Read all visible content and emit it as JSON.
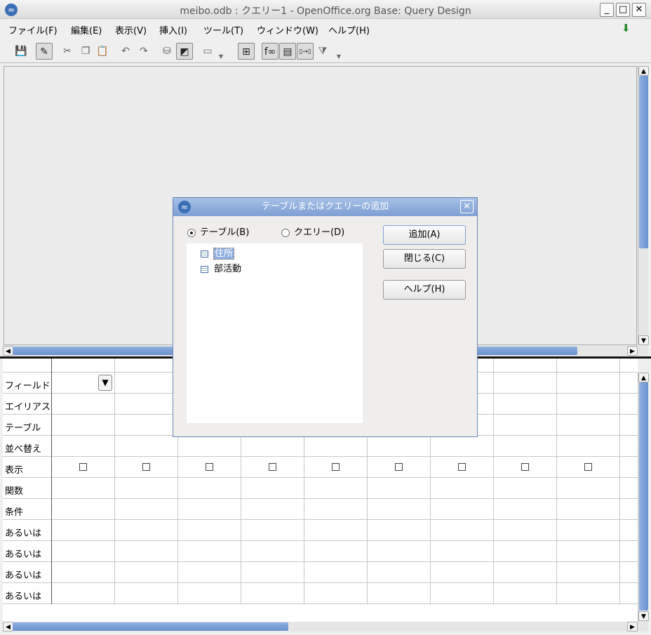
{
  "window": {
    "title": "meibo.odb : クエリー1  -  OpenOffice.org Base: Query Design",
    "minimize": "_",
    "maximize": "□",
    "close": "✕"
  },
  "menu": [
    "ファイル(F)",
    "編集(E)",
    "表示(V)",
    "挿入(I)",
    "ツール(T)",
    "ウィンドウ(W)",
    "ヘルプ(H)"
  ],
  "toolbar": [
    {
      "icon": "save-icon",
      "glyph": "💾",
      "on": false
    },
    {
      "icon": "edit-mode-icon",
      "glyph": "✎",
      "on": true
    },
    {
      "icon": "cut-icon",
      "glyph": "✂",
      "on": false
    },
    {
      "icon": "copy-icon",
      "glyph": "❐",
      "on": false
    },
    {
      "icon": "paste-icon",
      "glyph": "📋",
      "on": false
    },
    {
      "icon": "undo-icon",
      "glyph": "↶",
      "on": false
    },
    {
      "icon": "redo-icon",
      "glyph": "↷",
      "on": false
    },
    {
      "icon": "run-query-icon",
      "glyph": "⛁",
      "on": false
    },
    {
      "icon": "design-view-icon",
      "glyph": "◩",
      "on": true
    },
    {
      "icon": "clear-query-icon",
      "glyph": "▭",
      "on": false
    },
    {
      "icon": "add-table-icon",
      "glyph": "⊞",
      "on": true
    },
    {
      "icon": "functions-icon",
      "glyph": "f∞",
      "on": true
    },
    {
      "icon": "table-name-icon",
      "glyph": "▤",
      "on": true
    },
    {
      "icon": "alias-icon",
      "glyph": "▯→▯",
      "on": true
    },
    {
      "icon": "distinct-values-icon",
      "glyph": "⧩",
      "on": false
    }
  ],
  "grid": {
    "row_labels": [
      "フィールド",
      "エイリアス",
      "テーブル",
      "並べ替え",
      "表示",
      "関数",
      "条件",
      "あるいは",
      "あるいは",
      "あるいは",
      "あるいは"
    ],
    "columns": 9,
    "visible_checked": [
      false,
      false,
      false,
      false,
      false,
      false,
      false,
      false,
      false
    ]
  },
  "dialog": {
    "title": "テーブルまたはクエリーの追加",
    "radio_tables": "テーブル(B)",
    "radio_queries": "クエリー(D)",
    "selected": "tables",
    "items": [
      "住所",
      "部活動"
    ],
    "selected_item": "住所",
    "add": "追加(A)",
    "close": "閉じる(C)",
    "help": "ヘルプ(H)"
  },
  "colors": {
    "accent": "#7e9fd4",
    "scroll_thumb": "#6a91cf"
  }
}
